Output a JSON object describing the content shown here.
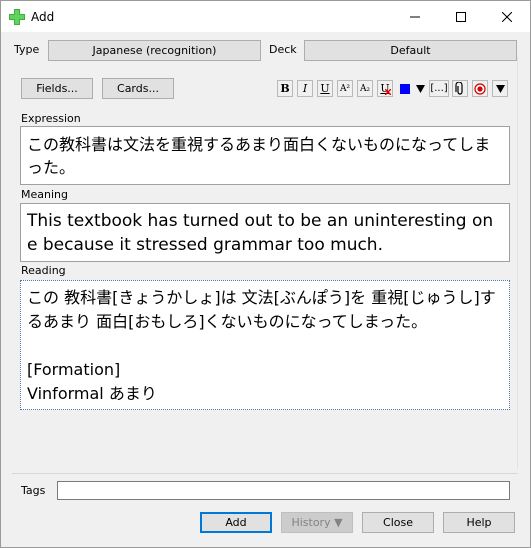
{
  "window": {
    "title": "Add"
  },
  "header": {
    "type_label": "Type",
    "type_value": "Japanese (recognition)",
    "deck_label": "Deck",
    "deck_value": "Default"
  },
  "toolbar": {
    "fields_label": "Fields...",
    "cards_label": "Cards...",
    "bold": "B",
    "italic": "I",
    "underline": "U",
    "superscript": "A²",
    "subscript": "A₂",
    "clear_format": "U",
    "cloze": "[...]",
    "text_color": "#0000ff"
  },
  "fields": [
    {
      "label": "Expression",
      "value": "この教科書は文法を重視するあまり面白くないものになってしまった。"
    },
    {
      "label": "Meaning",
      "value": "This textbook has turned out to be an uninteresting one because it stressed grammar too much."
    },
    {
      "label": "Reading",
      "value": "この 教科書[きょうかしょ]は 文法[ぶんぽう]を 重視[じゅうし]するあまり 面白[おもしろ]くないものになってしまった。\n\n[Formation]\nVinformal あまり"
    }
  ],
  "tags": {
    "label": "Tags",
    "value": ""
  },
  "footer": {
    "add_label": "Add",
    "history_label": "History ▼",
    "close_label": "Close",
    "help_label": "Help"
  }
}
